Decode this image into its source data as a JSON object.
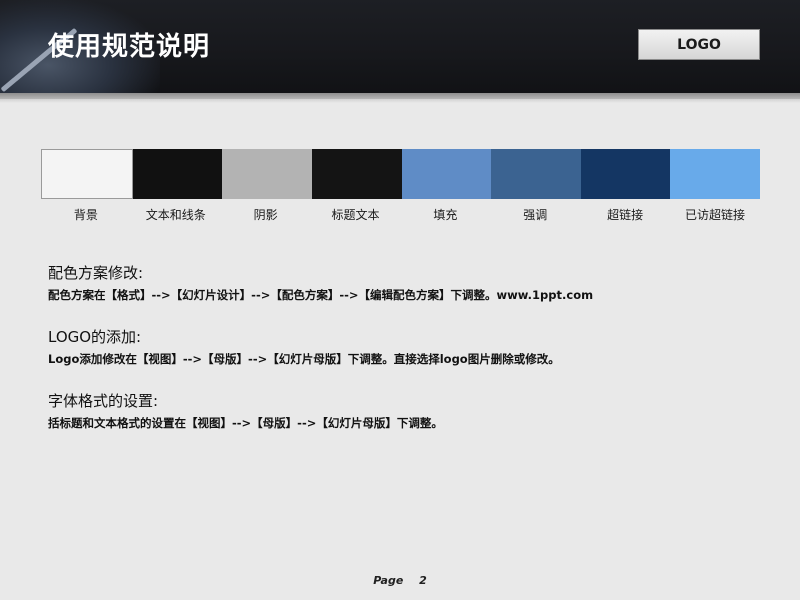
{
  "header": {
    "title": "使用规范说明",
    "logo_text": "LOGO"
  },
  "palette": {
    "swatches": [
      {
        "label": "背景",
        "color": "#f4f4f4"
      },
      {
        "label": "文本和线条",
        "color": "#111111"
      },
      {
        "label": "阴影",
        "color": "#b3b3b3"
      },
      {
        "label": "标题文本",
        "color": "#141414"
      },
      {
        "label": "填充",
        "color": "#5f8cc6"
      },
      {
        "label": "强调",
        "color": "#3b6391"
      },
      {
        "label": "超链接",
        "color": "#143663"
      },
      {
        "label": "已访超链接",
        "color": "#68aaea"
      }
    ]
  },
  "sections": [
    {
      "title": "配色方案修改:",
      "body": "配色方案在【格式】-->【幻灯片设计】-->【配色方案】-->【编辑配色方案】下调整。www.1ppt.com"
    },
    {
      "title": "LOGO的添加:",
      "body": "Logo添加修改在【视图】-->【母版】-->【幻灯片母版】下调整。直接选择logo图片删除或修改。"
    },
    {
      "title": "字体格式的设置:",
      "body": "括标题和文本格式的设置在【视图】-->【母版】-->【幻灯片母版】下调整。"
    }
  ],
  "footer": {
    "label": "Page",
    "number": "2"
  }
}
